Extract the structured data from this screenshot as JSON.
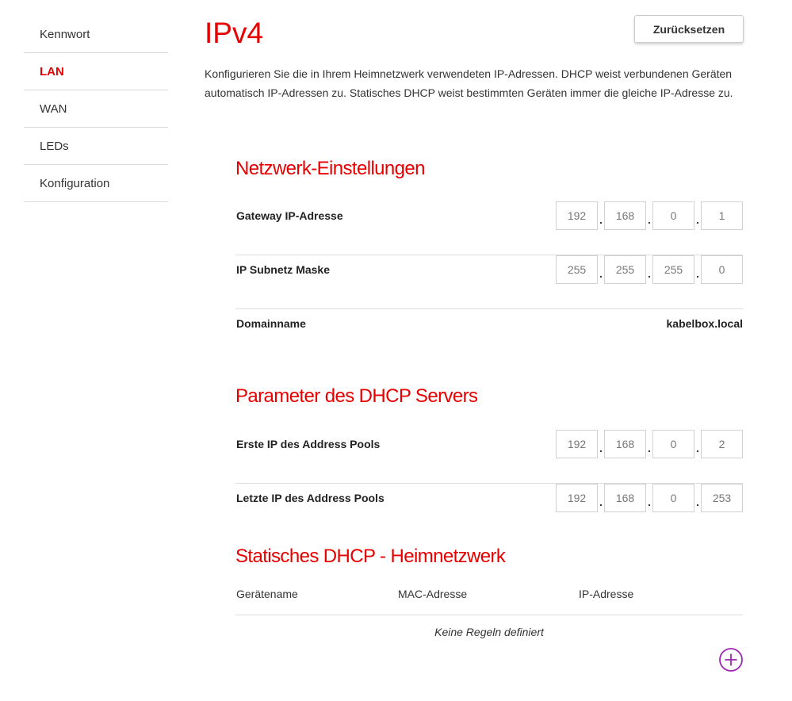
{
  "sidebar": {
    "items": [
      {
        "label": "Kennwort"
      },
      {
        "label": "LAN"
      },
      {
        "label": "WAN"
      },
      {
        "label": "LEDs"
      },
      {
        "label": "Konfiguration"
      }
    ],
    "active": "LAN"
  },
  "page": {
    "title": "IPv4",
    "reset_label": "Zurücksetzen",
    "intro": "Konfigurieren Sie die in Ihrem Heimnetzwerk verwendeten IP-Adressen. DHCP weist verbundenen Geräten automatisch IP-Adressen zu. Statisches DHCP weist bestimmten Geräten immer die gleiche IP-Adresse zu."
  },
  "network": {
    "title": "Netzwerk-Einstellungen",
    "gateway": {
      "label": "Gateway IP-Adresse",
      "octets": [
        "192",
        "168",
        "0",
        "1"
      ]
    },
    "subnet": {
      "label": "IP Subnetz Maske",
      "octets": [
        "255",
        "255",
        "255",
        "0"
      ]
    },
    "domain": {
      "label": "Domainname",
      "value": "kabelbox.local"
    }
  },
  "dhcp": {
    "title": "Parameter des DHCP Servers",
    "first": {
      "label": "Erste IP des Address Pools",
      "octets": [
        "192",
        "168",
        "0",
        "2"
      ]
    },
    "last": {
      "label": "Letzte IP des Address Pools",
      "octets": [
        "192",
        "168",
        "0",
        "253"
      ]
    }
  },
  "static_dhcp": {
    "title": "Statisches DHCP - Heimnetzwerk",
    "columns": [
      "Gerätename",
      "MAC-Adresse",
      "IP-Adresse"
    ],
    "empty_message": "Keine Regeln definiert",
    "add_icon": "plus-circle-icon"
  },
  "colors": {
    "accent": "#e60000",
    "add_icon": "#9c27b0",
    "divider": "#dcdcdc"
  }
}
